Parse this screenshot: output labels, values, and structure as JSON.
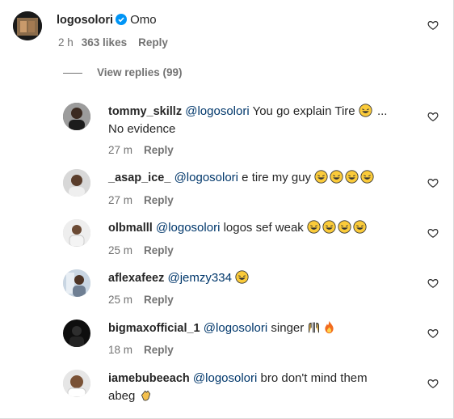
{
  "main_comment": {
    "username": "logosolori",
    "text": "Omo",
    "time": "2 h",
    "likes": "363 likes",
    "reply_label": "Reply"
  },
  "view_replies": "View replies (99)",
  "replies": [
    {
      "username": "tommy_skillz",
      "mention": "@logosolori",
      "text": " You go explain Tire",
      "after_emoji": " ...",
      "line2": "No evidence",
      "time": "27 m",
      "reply_label": "Reply"
    },
    {
      "username": "_asap_ice_",
      "mention": "@logosolori",
      "text": " e tire my guy ",
      "time": "27 m",
      "reply_label": "Reply"
    },
    {
      "username": "olbmalll",
      "mention": "@logosolori",
      "text": " logos sef weak ",
      "time": "25 m",
      "reply_label": "Reply"
    },
    {
      "username": "aflexafeez",
      "mention": "@jemzy334",
      "text": " ",
      "time": "25 m",
      "reply_label": "Reply"
    },
    {
      "username": "bigmaxofficial_1",
      "mention": "@logosolori",
      "text": " singer ",
      "time": "18 m",
      "reply_label": "Reply"
    },
    {
      "username": "iamebubeeach",
      "mention": "@logosolori",
      "text": " bro don't mind them",
      "line2": "abeg ",
      "time": "",
      "reply_label": ""
    }
  ],
  "icons": {
    "heart": "heart-outline-icon",
    "verified": "verified-badge-icon",
    "laughing": "laughing-emoji-icon",
    "praying": "raised-hands-emoji-icon",
    "fire": "fire-emoji-icon",
    "clap": "clapping-hands-emoji-icon"
  },
  "colors": {
    "mention": "#00376b",
    "verified": "#0095f6",
    "meta": "#737373"
  }
}
